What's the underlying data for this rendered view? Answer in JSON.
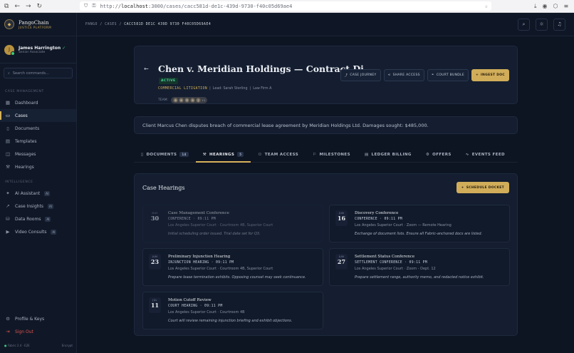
{
  "browser": {
    "url_prefix": "http://",
    "url_host": "localhost",
    "url_path": ":3000/cases/cacc581d-de1c-439d-9730-f40c05d69ae4"
  },
  "brand": {
    "name": "PangoChain",
    "tagline": "JUSTICE PLATFORM"
  },
  "user": {
    "initials": "J",
    "name": "James Harrington",
    "role": "Senior Associate"
  },
  "search": {
    "placeholder": "Search commands..."
  },
  "sidebar": {
    "case_section": "CASE MANAGEMENT",
    "case_items": [
      {
        "label": "Dashboard",
        "icon": "grid-icon"
      },
      {
        "label": "Cases",
        "icon": "folder-icon"
      },
      {
        "label": "Documents",
        "icon": "document-icon"
      },
      {
        "label": "Templates",
        "icon": "template-icon"
      },
      {
        "label": "Messages",
        "icon": "message-icon"
      },
      {
        "label": "Hearings",
        "icon": "gavel-icon"
      }
    ],
    "intel_section": "INTELLIGENCE",
    "intel_items": [
      {
        "label": "AI Assistant",
        "badge": "AI"
      },
      {
        "label": "Case Insights",
        "badge": "AI"
      },
      {
        "label": "Data Rooms",
        "badge": "AI"
      },
      {
        "label": "Video Consults",
        "badge": "AI"
      }
    ],
    "profile": "Profile & Keys",
    "signout": "Sign Out",
    "version_left": "Fabric 2.4 · E2E",
    "version_right": "Encrypt"
  },
  "breadcrumb": {
    "root": "PANGO",
    "section": "CASES",
    "current": "CACC581D DE1C 439D 9730 F40C05D69AE4"
  },
  "case": {
    "title": "Chen v. Meridian Holdings — Contract Di...",
    "status": "ACTIVE",
    "type": "COMMERCIAL LITIGATION",
    "lead": "Lead: Sarah Sterling",
    "firm": "Law Firm A",
    "team_label": "TEAM:",
    "team": [
      "A",
      "A",
      "S",
      "A",
      "J",
      "+1"
    ]
  },
  "actions": {
    "journey": "CASE JOURNEY",
    "share": "SHARE ACCESS",
    "bundle": "COURT BUNDLE",
    "ingest": "INGEST DOC"
  },
  "description": "Client Marcus Chen disputes breach of commercial lease agreement by Meridian Holdings Ltd. Damages sought: $485,000.",
  "tabs": [
    {
      "label": "DOCUMENTS",
      "count": "14"
    },
    {
      "label": "HEARINGS",
      "count": "5"
    },
    {
      "label": "TEAM ACCESS",
      "count": ""
    },
    {
      "label": "MILESTONES",
      "count": ""
    },
    {
      "label": "LEDGER BILLING",
      "count": ""
    },
    {
      "label": "OFFERS",
      "count": ""
    },
    {
      "label": "EVENTS FEED",
      "count": ""
    }
  ],
  "hearings": {
    "title": "Case Hearings",
    "schedule": "SCHEDULE DOCKET",
    "items": [
      {
        "month": "MAY",
        "day": "30",
        "title": "Case Management Conference",
        "type": "CONFERENCE · 09:11 PM",
        "location": "Los Angeles Superior Court · Courtroom 4B, Superior Court",
        "note": "Initial scheduling order issued. Trial date set for Q3."
      },
      {
        "month": "JUN",
        "day": "16",
        "title": "Discovery Conference",
        "type": "CONFERENCE · 09:11 PM",
        "location": "Los Angeles Superior Court · Zoom — Remote Hearing",
        "note": "Exchange of document lists. Ensure all Fabric-anchored docs are listed."
      },
      {
        "month": "JUN",
        "day": "23",
        "title": "Preliminary Injunction Hearing",
        "type": "INJUNCTION HEARING · 09:11 PM",
        "location": "Los Angeles Superior Court · Courtroom 4B, Superior Court",
        "note": "Prepare lease termination exhibits. Opposing counsel may seek continuance."
      },
      {
        "month": "JUN",
        "day": "27",
        "title": "Settlement Status Conference",
        "type": "SETTLEMENT CONFERENCE · 09:11 PM",
        "location": "Los Angeles Superior Court · Zoom - Dept. 12",
        "note": "Prepare settlement range, authority memo, and redacted notice exhibit."
      },
      {
        "month": "JUL",
        "day": "11",
        "title": "Motion Cutoff Review",
        "type": "COURT HEARING · 09:11 PM",
        "location": "Los Angeles Superior Court · Courtroom 4B",
        "note": "Court will review remaining injunction briefing and exhibit objections."
      }
    ]
  }
}
